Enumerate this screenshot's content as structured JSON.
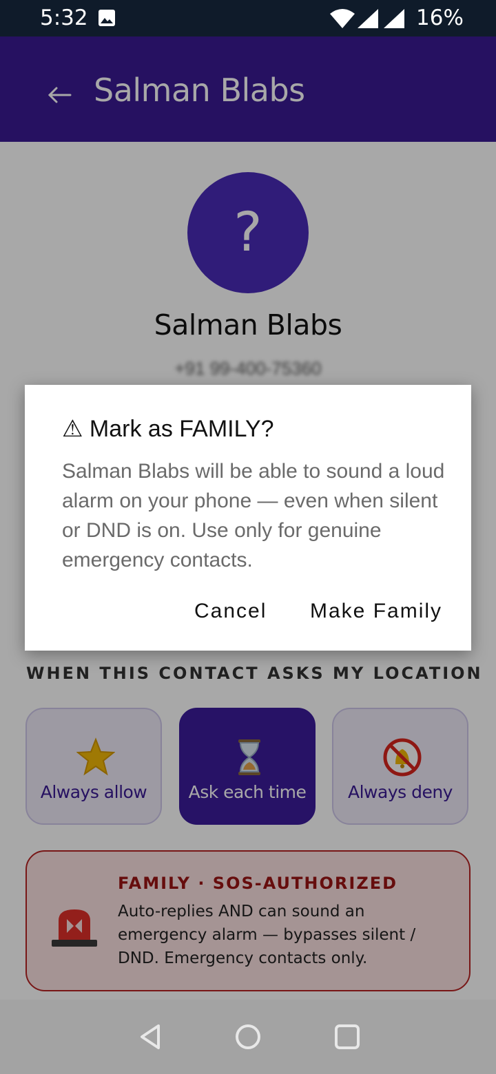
{
  "status_bar": {
    "time": "5:32",
    "battery": "16%",
    "icons": [
      "image-icon",
      "wifi-icon",
      "signal-icon",
      "signal-icon"
    ]
  },
  "app_bar": {
    "title": "Salman Blabs",
    "back_icon": "arrow-left"
  },
  "contact": {
    "avatar_glyph": "?",
    "name": "Salman Blabs",
    "number": "+91 99-400-75360"
  },
  "location_section": {
    "label": "WHEN THIS CONTACT ASKS MY LOCATION",
    "options": [
      {
        "label": "Always allow",
        "icon": "star-icon",
        "selected": false
      },
      {
        "label": "Ask each time",
        "icon": "hourglass-icon",
        "selected": true
      },
      {
        "label": "Always deny",
        "icon": "no-bell-icon",
        "selected": false
      }
    ]
  },
  "family_card": {
    "title": "FAMILY · SOS-AUTHORIZED",
    "description": "Auto-replies AND can sound an emergency alarm — bypasses silent / DND. Emergency contacts only.",
    "icon": "siren-icon"
  },
  "dialog": {
    "title": "⚠ Mark as FAMILY?",
    "body": "Salman Blabs will be able to sound a loud alarm on your phone — even when silent or DND is on. Use only for genuine emergency contacts.",
    "cancel_label": "Cancel",
    "confirm_label": "Make Family"
  },
  "colors": {
    "primary": "#3a1a94",
    "status_bar": "#0f1b2a",
    "danger": "#b72323",
    "danger_bg": "#fbe1e1"
  },
  "nav_bar": {
    "icons": [
      "back-triangle-icon",
      "home-circle-icon",
      "recents-square-icon"
    ]
  }
}
